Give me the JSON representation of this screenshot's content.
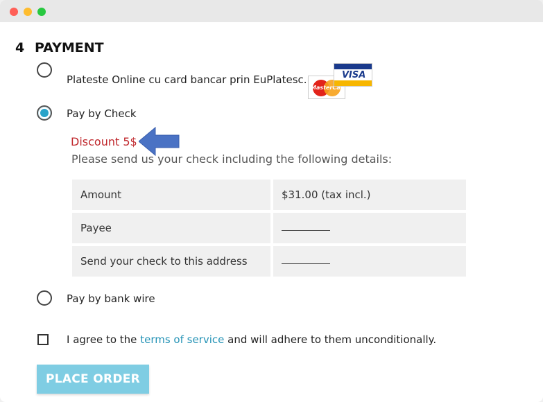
{
  "section": {
    "number": "4",
    "title": "PAYMENT"
  },
  "options": [
    {
      "label": "Plateste Online cu card bancar prin EuPlatesc.ro",
      "selected": false
    },
    {
      "label": "Pay by Check",
      "selected": true
    },
    {
      "label": "Pay by bank wire",
      "selected": false
    }
  ],
  "cards": {
    "mastercard": "MasterCard",
    "visa": "VISA"
  },
  "check": {
    "discount": "Discount 5$",
    "intro": "Please send us your check including the following details:",
    "rows": [
      {
        "label": "Amount",
        "value": "$31.00 (tax incl.)"
      },
      {
        "label": "Payee",
        "value": ""
      },
      {
        "label": "Send your check to this address",
        "value": ""
      }
    ]
  },
  "terms": {
    "prefix": "I agree to the",
    "link": "terms of service",
    "suffix": "and will adhere to them unconditionally.",
    "checked": false
  },
  "place_order": "PLACE ORDER",
  "colors": {
    "accent": "#27a3c9",
    "button": "#7fcde3",
    "discount": "#c0282d",
    "arrow": "#4a72c4",
    "link": "#2593b6"
  }
}
